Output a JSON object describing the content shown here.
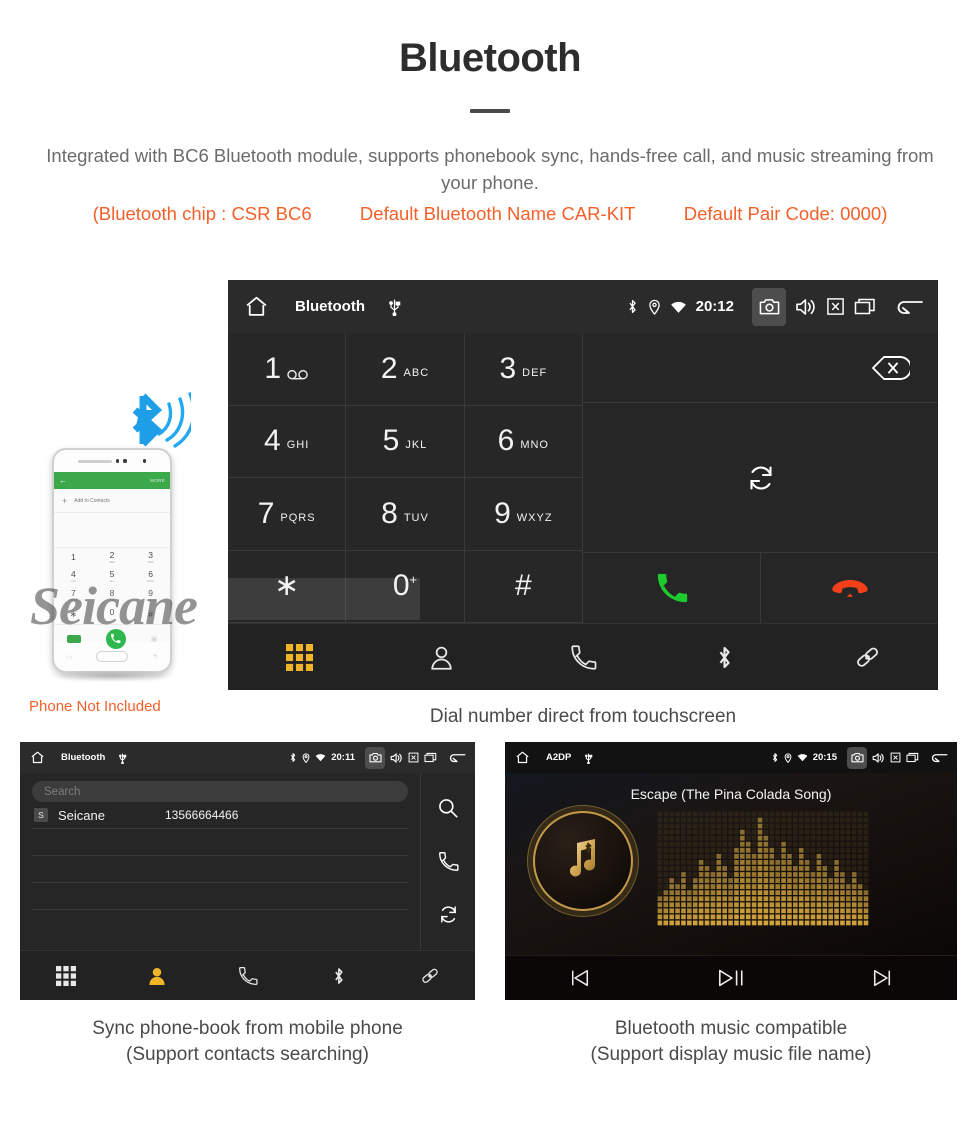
{
  "header": {
    "title": "Bluetooth",
    "intro": "Integrated with BC6 Bluetooth module, supports phonebook sync, hands-free call, and music streaming from your phone.",
    "spec_chip": "(Bluetooth chip : CSR BC6",
    "spec_name": "Default Bluetooth Name CAR-KIT",
    "spec_pair": "Default Pair Code: 0000)",
    "accent_color": "#f4602a",
    "body_color": "#6b6b6b"
  },
  "watermark": "Seicane",
  "phone_mock": {
    "caption": "Phone Not Included",
    "app_back": "←",
    "app_more": "MORE",
    "add_contact": "Add to Contacts",
    "keys": [
      {
        "digit": "1",
        "letters": "∞"
      },
      {
        "digit": "2",
        "letters": "ABC"
      },
      {
        "digit": "3",
        "letters": "DEF"
      },
      {
        "digit": "4",
        "letters": "GHI"
      },
      {
        "digit": "5",
        "letters": "JKL"
      },
      {
        "digit": "6",
        "letters": "MNO"
      },
      {
        "digit": "7",
        "letters": "PQRS"
      },
      {
        "digit": "8",
        "letters": "TUV"
      },
      {
        "digit": "9",
        "letters": "WXYZ"
      },
      {
        "digit": "∗",
        "letters": ""
      },
      {
        "digit": "0",
        "letters": "+"
      },
      {
        "digit": "#",
        "letters": ""
      }
    ]
  },
  "dialer_screen": {
    "statusbar": {
      "title": "Bluetooth",
      "time": "20:12",
      "icons": [
        "home-icon",
        "usb-icon",
        "bluetooth-icon",
        "location-icon",
        "wifi-icon",
        "camera-icon",
        "volume-icon",
        "close-box-icon",
        "recents-icon",
        "back-icon"
      ]
    },
    "number_value": "",
    "keys": [
      {
        "digit": "1",
        "letters": "∞",
        "sup": ""
      },
      {
        "digit": "2",
        "letters": "ABC",
        "sup": ""
      },
      {
        "digit": "3",
        "letters": "DEF",
        "sup": ""
      },
      {
        "digit": "4",
        "letters": "GHI",
        "sup": ""
      },
      {
        "digit": "5",
        "letters": "JKL",
        "sup": ""
      },
      {
        "digit": "6",
        "letters": "MNO",
        "sup": ""
      },
      {
        "digit": "7",
        "letters": "PQRS",
        "sup": ""
      },
      {
        "digit": "8",
        "letters": "TUV",
        "sup": ""
      },
      {
        "digit": "9",
        "letters": "WXYZ",
        "sup": ""
      },
      {
        "digit": "∗",
        "letters": "",
        "sup": ""
      },
      {
        "digit": "0",
        "letters": "",
        "sup": "+"
      },
      {
        "digit": "#",
        "letters": "",
        "sup": ""
      }
    ],
    "nav": [
      "keypad-icon",
      "contacts-icon",
      "call-log-icon",
      "bluetooth-icon",
      "link-icon"
    ],
    "active_nav": "keypad-icon",
    "active_nav_color": "#f0b429",
    "call_color": "#1ecb2e",
    "hangup_color": "#f4401a",
    "caption": "Dial number direct from touchscreen"
  },
  "phonebook_screen": {
    "statusbar": {
      "title": "Bluetooth",
      "time": "20:11"
    },
    "search_placeholder": "Search",
    "contacts": [
      {
        "badge": "S",
        "name": "Seicane",
        "number": "13566664466"
      }
    ],
    "side_icons": [
      "search-icon",
      "call-icon",
      "sync-icon"
    ],
    "nav": [
      "keypad-icon",
      "contacts-icon",
      "call-log-icon",
      "bluetooth-icon",
      "link-icon"
    ],
    "active_nav": "contacts-icon",
    "caption_line1": "Sync phone-book from mobile phone",
    "caption_line2": "(Support contacts searching)"
  },
  "music_screen": {
    "statusbar": {
      "title": "A2DP",
      "time": "20:15"
    },
    "song_title": "Escape (The Pina Colada Song)",
    "controls": [
      "previous-icon",
      "play-pause-icon",
      "next-icon"
    ],
    "accent_color": "#c49a4a",
    "caption_line1": "Bluetooth music compatible",
    "caption_line2": "(Support display music file name)"
  }
}
